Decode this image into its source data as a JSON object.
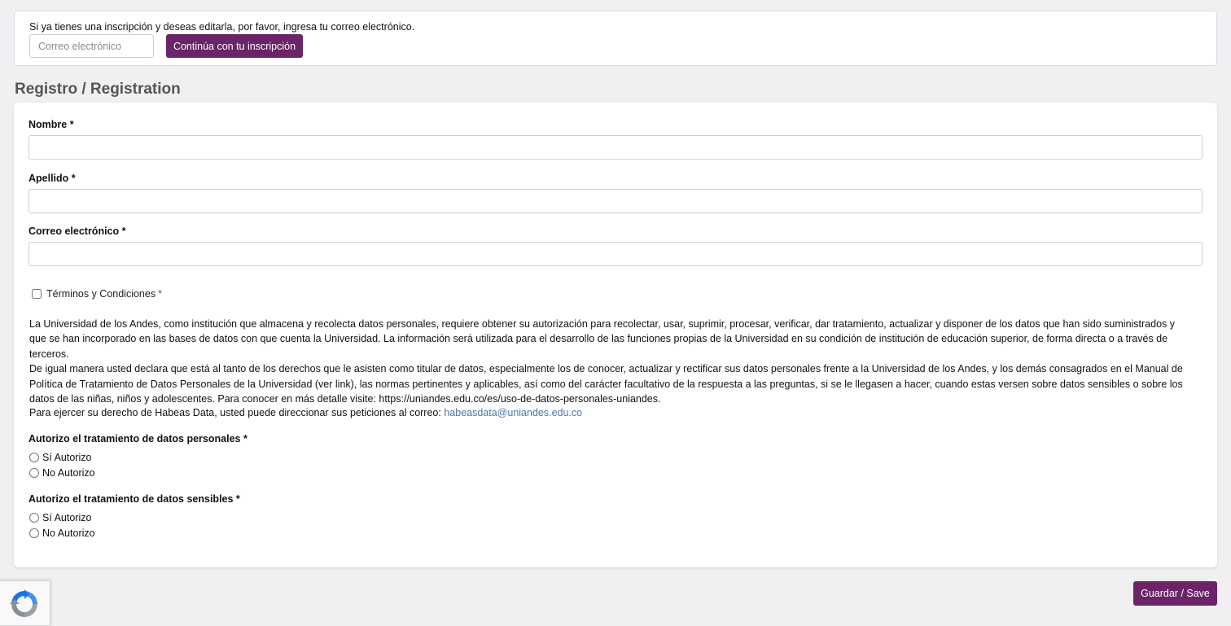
{
  "top": {
    "intro_text": "Si ya tienes una inscripción y deseas editarla, por favor, ingresa tu correo electrónico.",
    "email_placeholder": "Correo electrónico",
    "continue_label": "Continúa con tu inscripción"
  },
  "section_title": "Registro / Registration",
  "form": {
    "fields": [
      {
        "label": "Nombre *",
        "value": ""
      },
      {
        "label": "Apellido *",
        "value": ""
      },
      {
        "label": "Correo electrónico *",
        "value": ""
      }
    ],
    "terms": {
      "label": "Términos y Condiciones",
      "required_mark": "*",
      "checked": false
    },
    "legal_paragraph_1": "La Universidad de los Andes, como institución que almacena y recolecta datos personales, requiere obtener su autorización para recolectar, usar, suprimir, procesar, verificar, dar tratamiento, actualizar y disponer de los datos que han sido suministrados y que se han incorporado en las bases de datos con que cuenta la Universidad. La información será utilizada para el desarrollo de las funciones propias de la Universidad en su condición de institución de educación superior, de forma directa o a través de terceros.",
    "legal_paragraph_2": "De igual manera usted declara que está al tanto de los derechos que le asisten como titular de datos, especialmente los de conocer, actualizar y rectificar sus datos personales frente a la Universidad de los Andes, y los demás consagrados en el Manual de Política de Tratamiento de Datos Personales de la Universidad (ver link), las normas pertinentes y aplicables, así como del carácter facultativo de la respuesta a las preguntas, si se le llegasen a hacer, cuando estas versen sobre datos sensibles o sobre los datos de las niñas, niños y adolescentes. Para conocer en más detalle visite: https://uniandes.edu.co/es/uso-de-datos-personales-uniandes.",
    "habeas_text": "Para ejercer su derecho de Habeas Data, usted puede direccionar sus peticiones al correo:",
    "habeas_email": "habeasdata@uniandes.edu.co",
    "personal_data": {
      "label": "Autorizo el tratamiento de datos personales *",
      "options": [
        "Sí Autorizo",
        "No Autorizo"
      ]
    },
    "sensitive_data": {
      "label": "Autorizo el tratamiento de datos sensibles *",
      "options": [
        "Sí Autorizo",
        "No Autorizo"
      ]
    }
  },
  "save_label": "Guardar / Save",
  "colors": {
    "primary": "#6b2468",
    "link": "#4a76a8",
    "background": "#f1eff2"
  },
  "icons": {
    "recaptcha": "recaptcha-icon"
  }
}
